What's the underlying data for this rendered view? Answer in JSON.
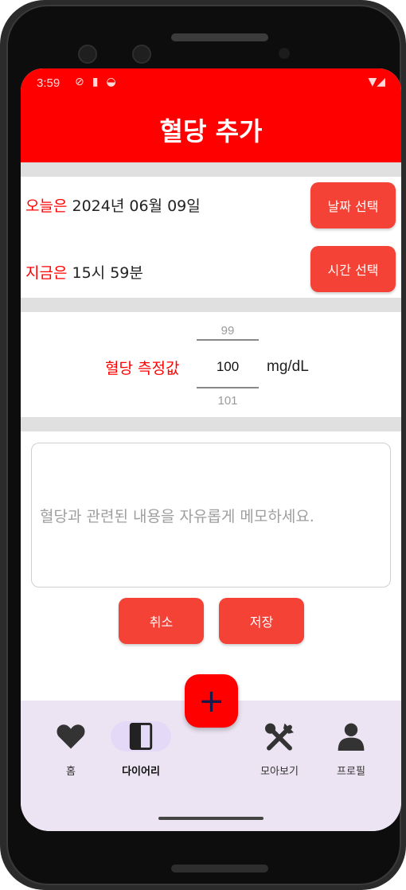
{
  "status_bar": {
    "time": "3:59",
    "icons_left": [
      "no-disturb-icon",
      "sd-card-icon",
      "android-icon"
    ],
    "icons_right": [
      "wifi-icon",
      "signal-icon"
    ]
  },
  "header": {
    "title": "혈당 추가"
  },
  "date_row": {
    "prefix": "오늘은",
    "value": "2024년 06월 09일",
    "button_label": "날짜 선택"
  },
  "time_row": {
    "prefix": "지금은",
    "value": "15시 59분",
    "button_label": "시간 선택"
  },
  "glucose_picker": {
    "label": "혈당 측정값",
    "prev_value": "99",
    "current_value": "100",
    "next_value": "101",
    "unit": "mg/dL"
  },
  "memo": {
    "placeholder": "혈당과 관련된 내용을 자유롭게 메모하세요.",
    "value": ""
  },
  "actions": {
    "cancel_label": "취소",
    "save_label": "저장"
  },
  "fab": {
    "icon": "plus-icon"
  },
  "bottom_nav": {
    "items": [
      {
        "label": "홈",
        "icon": "heart-icon",
        "active": false
      },
      {
        "label": "다이어리",
        "icon": "diary-icon",
        "active": true
      },
      {
        "label": "모아보기",
        "icon": "utensils-icon",
        "active": false
      },
      {
        "label": "프로필",
        "icon": "person-icon",
        "active": false
      }
    ]
  },
  "colors": {
    "header_bg": "#ff0000",
    "accent_button": "#f44336",
    "nav_bg": "#ece4f3",
    "active_pill": "#e4d9f6"
  }
}
